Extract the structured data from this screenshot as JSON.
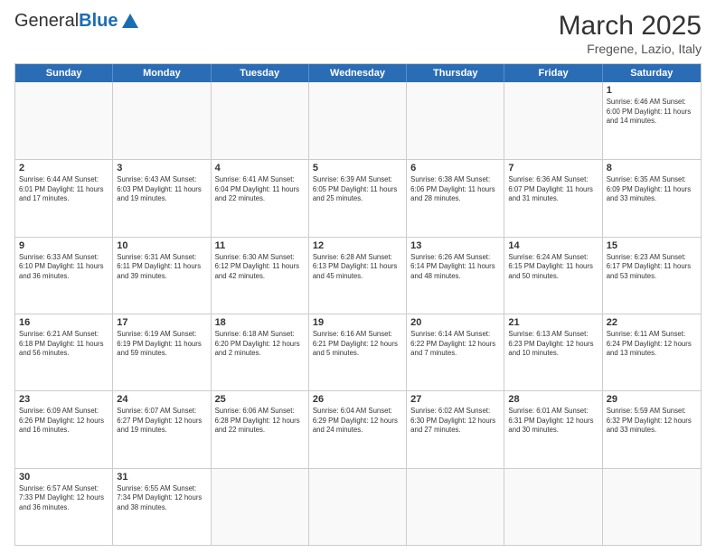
{
  "header": {
    "logo_general": "General",
    "logo_blue": "Blue",
    "main_title": "March 2025",
    "sub_title": "Fregene, Lazio, Italy"
  },
  "weekdays": [
    "Sunday",
    "Monday",
    "Tuesday",
    "Wednesday",
    "Thursday",
    "Friday",
    "Saturday"
  ],
  "weeks": [
    [
      {
        "day": "",
        "info": ""
      },
      {
        "day": "",
        "info": ""
      },
      {
        "day": "",
        "info": ""
      },
      {
        "day": "",
        "info": ""
      },
      {
        "day": "",
        "info": ""
      },
      {
        "day": "",
        "info": ""
      },
      {
        "day": "1",
        "info": "Sunrise: 6:46 AM\nSunset: 6:00 PM\nDaylight: 11 hours and 14 minutes."
      }
    ],
    [
      {
        "day": "2",
        "info": "Sunrise: 6:44 AM\nSunset: 6:01 PM\nDaylight: 11 hours and 17 minutes."
      },
      {
        "day": "3",
        "info": "Sunrise: 6:43 AM\nSunset: 6:03 PM\nDaylight: 11 hours and 19 minutes."
      },
      {
        "day": "4",
        "info": "Sunrise: 6:41 AM\nSunset: 6:04 PM\nDaylight: 11 hours and 22 minutes."
      },
      {
        "day": "5",
        "info": "Sunrise: 6:39 AM\nSunset: 6:05 PM\nDaylight: 11 hours and 25 minutes."
      },
      {
        "day": "6",
        "info": "Sunrise: 6:38 AM\nSunset: 6:06 PM\nDaylight: 11 hours and 28 minutes."
      },
      {
        "day": "7",
        "info": "Sunrise: 6:36 AM\nSunset: 6:07 PM\nDaylight: 11 hours and 31 minutes."
      },
      {
        "day": "8",
        "info": "Sunrise: 6:35 AM\nSunset: 6:09 PM\nDaylight: 11 hours and 33 minutes."
      }
    ],
    [
      {
        "day": "9",
        "info": "Sunrise: 6:33 AM\nSunset: 6:10 PM\nDaylight: 11 hours and 36 minutes."
      },
      {
        "day": "10",
        "info": "Sunrise: 6:31 AM\nSunset: 6:11 PM\nDaylight: 11 hours and 39 minutes."
      },
      {
        "day": "11",
        "info": "Sunrise: 6:30 AM\nSunset: 6:12 PM\nDaylight: 11 hours and 42 minutes."
      },
      {
        "day": "12",
        "info": "Sunrise: 6:28 AM\nSunset: 6:13 PM\nDaylight: 11 hours and 45 minutes."
      },
      {
        "day": "13",
        "info": "Sunrise: 6:26 AM\nSunset: 6:14 PM\nDaylight: 11 hours and 48 minutes."
      },
      {
        "day": "14",
        "info": "Sunrise: 6:24 AM\nSunset: 6:15 PM\nDaylight: 11 hours and 50 minutes."
      },
      {
        "day": "15",
        "info": "Sunrise: 6:23 AM\nSunset: 6:17 PM\nDaylight: 11 hours and 53 minutes."
      }
    ],
    [
      {
        "day": "16",
        "info": "Sunrise: 6:21 AM\nSunset: 6:18 PM\nDaylight: 11 hours and 56 minutes."
      },
      {
        "day": "17",
        "info": "Sunrise: 6:19 AM\nSunset: 6:19 PM\nDaylight: 11 hours and 59 minutes."
      },
      {
        "day": "18",
        "info": "Sunrise: 6:18 AM\nSunset: 6:20 PM\nDaylight: 12 hours and 2 minutes."
      },
      {
        "day": "19",
        "info": "Sunrise: 6:16 AM\nSunset: 6:21 PM\nDaylight: 12 hours and 5 minutes."
      },
      {
        "day": "20",
        "info": "Sunrise: 6:14 AM\nSunset: 6:22 PM\nDaylight: 12 hours and 7 minutes."
      },
      {
        "day": "21",
        "info": "Sunrise: 6:13 AM\nSunset: 6:23 PM\nDaylight: 12 hours and 10 minutes."
      },
      {
        "day": "22",
        "info": "Sunrise: 6:11 AM\nSunset: 6:24 PM\nDaylight: 12 hours and 13 minutes."
      }
    ],
    [
      {
        "day": "23",
        "info": "Sunrise: 6:09 AM\nSunset: 6:26 PM\nDaylight: 12 hours and 16 minutes."
      },
      {
        "day": "24",
        "info": "Sunrise: 6:07 AM\nSunset: 6:27 PM\nDaylight: 12 hours and 19 minutes."
      },
      {
        "day": "25",
        "info": "Sunrise: 6:06 AM\nSunset: 6:28 PM\nDaylight: 12 hours and 22 minutes."
      },
      {
        "day": "26",
        "info": "Sunrise: 6:04 AM\nSunset: 6:29 PM\nDaylight: 12 hours and 24 minutes."
      },
      {
        "day": "27",
        "info": "Sunrise: 6:02 AM\nSunset: 6:30 PM\nDaylight: 12 hours and 27 minutes."
      },
      {
        "day": "28",
        "info": "Sunrise: 6:01 AM\nSunset: 6:31 PM\nDaylight: 12 hours and 30 minutes."
      },
      {
        "day": "29",
        "info": "Sunrise: 5:59 AM\nSunset: 6:32 PM\nDaylight: 12 hours and 33 minutes."
      }
    ],
    [
      {
        "day": "30",
        "info": "Sunrise: 6:57 AM\nSunset: 7:33 PM\nDaylight: 12 hours and 36 minutes."
      },
      {
        "day": "31",
        "info": "Sunrise: 6:55 AM\nSunset: 7:34 PM\nDaylight: 12 hours and 38 minutes."
      },
      {
        "day": "",
        "info": ""
      },
      {
        "day": "",
        "info": ""
      },
      {
        "day": "",
        "info": ""
      },
      {
        "day": "",
        "info": ""
      },
      {
        "day": "",
        "info": ""
      }
    ]
  ]
}
